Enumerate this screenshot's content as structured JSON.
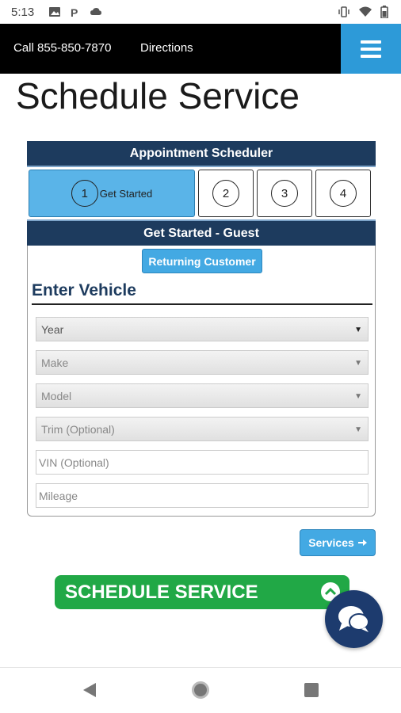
{
  "status_bar": {
    "time": "5:13"
  },
  "nav": {
    "call": "Call 855-850-7870",
    "directions": "Directions"
  },
  "page_title": "Schedule Service",
  "scheduler": {
    "header": "Appointment Scheduler",
    "steps": [
      {
        "number": "1",
        "label": "Get Started",
        "active": true
      },
      {
        "number": "2"
      },
      {
        "number": "3"
      },
      {
        "number": "4"
      }
    ],
    "sub_header": "Get Started - Guest",
    "returning_button": "Returning Customer",
    "section_title": "Enter Vehicle",
    "fields": {
      "year": "Year",
      "make": "Make",
      "model": "Model",
      "trim": "Trim (Optional)",
      "vin_placeholder": "VIN (Optional)",
      "mileage_placeholder": "Mileage"
    },
    "services_button": "Services"
  },
  "schedule_bar": {
    "label": "SCHEDULE SERVICE"
  },
  "colors": {
    "header_navy": "#1d3b5e",
    "accent_blue": "#43a9e3",
    "green": "#21a846",
    "chat_navy": "#1d3b6e"
  }
}
